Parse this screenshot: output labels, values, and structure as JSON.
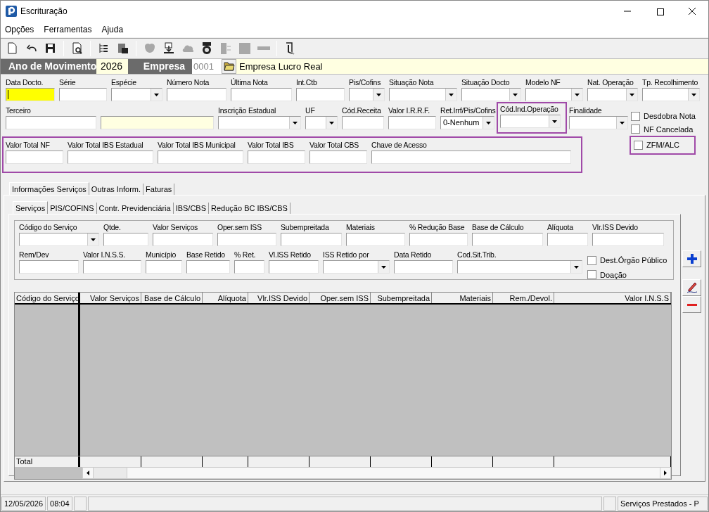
{
  "window": {
    "title": "Escrituração"
  },
  "menu": [
    {
      "label": "Opções"
    },
    {
      "label": "Ferramentas"
    },
    {
      "label": "Ajuda"
    }
  ],
  "toolbar": [
    [
      {
        "kind": "new",
        "disabled": false
      },
      {
        "kind": "undo",
        "disabled": false
      },
      {
        "kind": "save",
        "disabled": false
      }
    ],
    [
      {
        "kind": "preview",
        "disabled": false
      }
    ],
    [
      {
        "kind": "tree",
        "disabled": false
      },
      {
        "kind": "import",
        "disabled": false
      }
    ],
    [
      {
        "kind": "blob",
        "disabled": true
      },
      {
        "kind": "download",
        "disabled": false
      },
      {
        "kind": "cloud",
        "disabled": true
      },
      {
        "kind": "money",
        "disabled": false
      },
      {
        "kind": "panel",
        "disabled": true
      },
      {
        "kind": "square",
        "disabled": true
      },
      {
        "kind": "bar",
        "disabled": true
      }
    ],
    [
      {
        "kind": "exit",
        "disabled": false
      }
    ]
  ],
  "header": {
    "year_label": "Ano de Movimento",
    "year": "2026",
    "company_label": "Empresa",
    "company_code": "0001",
    "company_name": "Empresa Lucro Real"
  },
  "document_fields": [
    [
      {
        "label": "Data Docto.",
        "kind": "text",
        "focused": true,
        "highlighted": false
      },
      {
        "label": "Série",
        "kind": "text",
        "focused": false,
        "highlighted": false
      },
      {
        "label": "Espécie",
        "kind": "combo",
        "focused": false,
        "highlighted": false
      },
      {
        "label": "Número Nota",
        "kind": "text",
        "focused": false,
        "highlighted": false
      },
      {
        "label": "Última Nota",
        "kind": "text",
        "focused": false,
        "highlighted": false
      },
      {
        "label": "Int.Ctb",
        "kind": "text",
        "focused": false,
        "highlighted": false
      },
      {
        "label": "Pis/Cofins",
        "kind": "combo",
        "focused": false,
        "highlighted": false
      },
      {
        "label": "Situação Nota",
        "kind": "combo",
        "focused": false,
        "highlighted": false
      },
      {
        "label": "Situação Docto",
        "kind": "combo",
        "focused": false,
        "highlighted": false
      },
      {
        "label": "Modelo NF",
        "kind": "combo",
        "focused": false,
        "highlighted": false
      },
      {
        "label": "Nat. Operação",
        "kind": "combo",
        "focused": false,
        "highlighted": false
      },
      {
        "label": "Tp. Recolhimento",
        "kind": "combo",
        "focused": false,
        "highlighted": false
      }
    ],
    [
      {
        "label": "Terceiro",
        "kind": "text",
        "focused": false,
        "highlighted": false
      },
      {
        "kind": "readonly",
        "focused": false,
        "highlighted": false
      },
      {
        "label": "Inscrição Estadual",
        "kind": "combo",
        "focused": false,
        "highlighted": false
      },
      {
        "label": "UF",
        "kind": "combo",
        "focused": false,
        "highlighted": false
      },
      {
        "label": "Cód.Receita",
        "kind": "text",
        "focused": false,
        "highlighted": false
      },
      {
        "label": "Valor I.R.R.F.",
        "kind": "text",
        "focused": false,
        "highlighted": false
      },
      {
        "label": "Ret.Irrf/Pis/Cofins",
        "kind": "combo",
        "value": "0-Nenhum",
        "focused": false,
        "highlighted": false
      },
      {
        "label": "Cód.Ind.Operação",
        "kind": "combo",
        "focused": false,
        "highlighted": true
      },
      {
        "label": "Finalidade",
        "kind": "combo",
        "focused": false,
        "highlighted": false
      }
    ]
  ],
  "flags": [
    {
      "label": "Desdobra Nota",
      "checked": false,
      "highlighted": false
    },
    {
      "label": "NF Cancelada",
      "checked": false,
      "highlighted": false
    },
    {
      "label": "ZFM/ALC",
      "checked": false,
      "highlighted": true
    }
  ],
  "totals": {
    "highlighted": true,
    "fields": [
      {
        "label": "Valor Total NF"
      },
      {
        "label": "Valor Total IBS Estadual"
      },
      {
        "label": "Valor Total IBS Municipal"
      },
      {
        "label": "Valor Total IBS"
      },
      {
        "label": "Valor Total CBS"
      },
      {
        "label": "Chave de Acesso"
      }
    ]
  },
  "tabs": [
    {
      "label": "Informações Serviços",
      "selected": true
    },
    {
      "label": "Outras Inform.",
      "selected": false
    },
    {
      "label": "Faturas",
      "selected": false
    }
  ],
  "subtabs": [
    {
      "label": "Serviços",
      "selected": true
    },
    {
      "label": "PIS/COFINS",
      "selected": false
    },
    {
      "label": "Contr. Previdenciária",
      "selected": false
    },
    {
      "label": "IBS/CBS",
      "selected": false
    },
    {
      "label": "Redução BC IBS/CBS",
      "selected": false
    }
  ],
  "service_fields": [
    [
      {
        "label": "Código do Serviço",
        "kind": "combo"
      },
      {
        "label": "Qtde.",
        "kind": "text"
      },
      {
        "label": "Valor Serviços",
        "kind": "text"
      },
      {
        "label": "Oper.sem ISS",
        "kind": "text"
      },
      {
        "label": "Subempreitada",
        "kind": "text"
      },
      {
        "label": "Materiais",
        "kind": "text"
      },
      {
        "label": "% Redução Base",
        "kind": "text"
      },
      {
        "label": "Base de Cálculo",
        "kind": "text"
      },
      {
        "label": "Alíquota",
        "kind": "text"
      },
      {
        "label": "Vlr.ISS Devido",
        "kind": "text"
      }
    ],
    [
      {
        "label": "Rem/Dev",
        "kind": "text"
      },
      {
        "label": "Valor I.N.S.S.",
        "kind": "text"
      },
      {
        "label": "Município",
        "kind": "text"
      },
      {
        "label": "Base Retido",
        "kind": "text"
      },
      {
        "label": "% Ret.",
        "kind": "text"
      },
      {
        "label": "Vl.ISS Retido",
        "kind": "text"
      },
      {
        "label": "ISS Retido por",
        "kind": "combo"
      },
      {
        "label": "Data Retido",
        "kind": "text"
      },
      {
        "label": "Cod.Sit.Trib.",
        "kind": "combo"
      }
    ]
  ],
  "service_flags": [
    {
      "label": "Dest.Órgão Público",
      "checked": false
    },
    {
      "label": "Doação",
      "checked": false
    }
  ],
  "grid": {
    "columns": [
      "Código do Serviço",
      "Valor Serviços",
      "Base de Cálculo",
      "Alíquota",
      "Vlr.ISS Devido",
      "Oper.sem ISS",
      "Subempreitada",
      "Materiais",
      "Rem./Devol.",
      "Valor I.N.S.S"
    ],
    "total_label": "Total"
  },
  "side_buttons": [
    {
      "kind": "add"
    },
    {
      "kind": "edit"
    },
    {
      "kind": "remove"
    }
  ],
  "status_bar": {
    "date": "12/05/2026",
    "time": "08:04",
    "module": "Serviços Prestados - P"
  }
}
